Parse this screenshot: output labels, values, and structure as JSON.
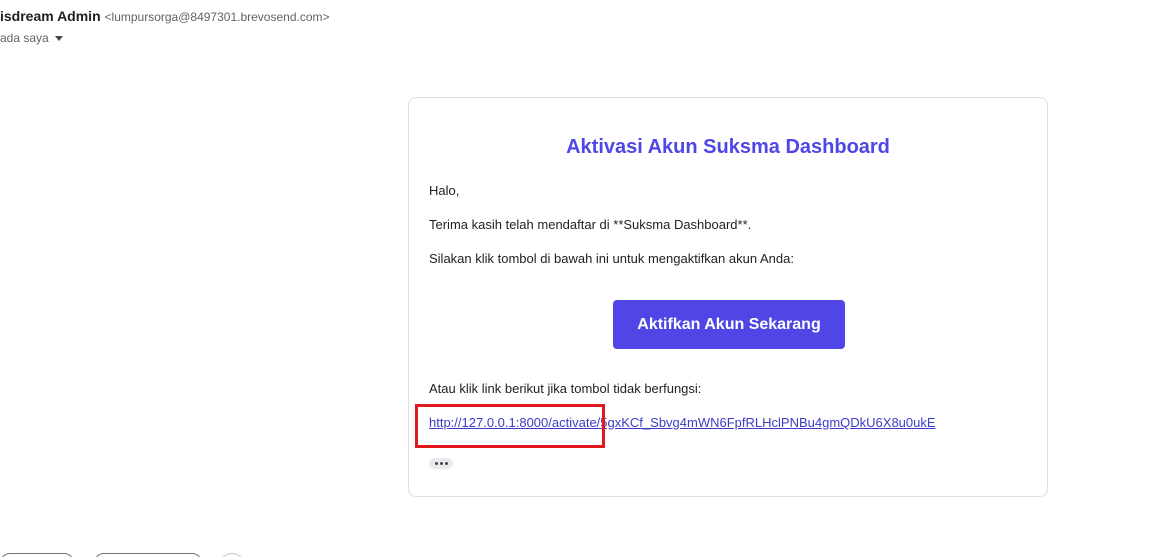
{
  "header": {
    "sender_name": "isdream Admin",
    "sender_email": "<lumpursorga@8497301.brevosend.com>",
    "recipient_label": "ada saya"
  },
  "email": {
    "title": "Aktivasi Akun Suksma Dashboard",
    "greeting": "Halo,",
    "thanks": "Terima kasih telah mendaftar di **Suksma Dashboard**.",
    "instruction": "Silakan klik tombol di bawah ini untuk mengaktifkan akun Anda:",
    "button_label": "Aktifkan Akun Sekarang",
    "fallback_text": "Atau klik link berikut jika tombol tidak berfungsi:",
    "activation_link": "http://127.0.0.1:8000/activate/5gxKCf_Sbvg4mWN6FpfRLHclPNBu4gmQDkU6X8u0ukE"
  },
  "colors": {
    "accent": "#4f46e5",
    "highlight": "#e0191f"
  }
}
